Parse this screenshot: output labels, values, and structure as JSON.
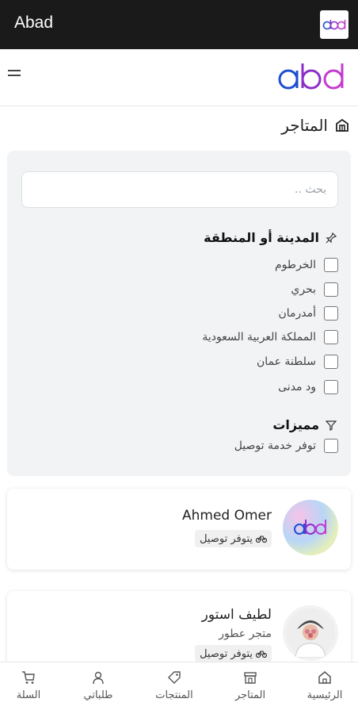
{
  "window": {
    "title": "Abad",
    "app_icon": "abd-logo-icon"
  },
  "header": {
    "menu_icon": "hamburger-icon",
    "logo": "abd"
  },
  "page": {
    "title": "المتاجر",
    "title_icon": "store-icon"
  },
  "filters": {
    "search": {
      "value": "",
      "placeholder": "بحث .."
    },
    "region": {
      "title": "المدينة أو المنطقة",
      "icon": "pin-icon",
      "options": [
        {
          "label": "الخرطوم",
          "checked": false
        },
        {
          "label": "بحري",
          "checked": false
        },
        {
          "label": "أمدرمان",
          "checked": false
        },
        {
          "label": "المملكة العربية السعودية",
          "checked": false
        },
        {
          "label": "سلطنة عمان",
          "checked": false
        },
        {
          "label": "ود مدنى",
          "checked": false
        }
      ]
    },
    "features": {
      "title": "مميزات",
      "icon": "filter-icon",
      "options": [
        {
          "label": "توفر خدمة توصيل",
          "checked": false
        }
      ]
    }
  },
  "stores": [
    {
      "name": "Ahmed Omer",
      "category": "",
      "badge": "يتوفر توصيل",
      "avatar": "abd-logo-avatar"
    },
    {
      "name": "لطيف استور",
      "category": "متجر عطور",
      "badge": "يتوفر توصيل",
      "avatar": "person-avatar"
    }
  ],
  "bottom_nav": [
    {
      "label": "الرئيسية",
      "icon": "home-icon"
    },
    {
      "label": "المتاجر",
      "icon": "store-icon"
    },
    {
      "label": "المنتجات",
      "icon": "tag-icon"
    },
    {
      "label": "طلباتي",
      "icon": "user-icon"
    },
    {
      "label": "السلة",
      "icon": "cart-icon"
    }
  ],
  "colors": {
    "logo_blue": "#1e4fd1",
    "logo_purple": "#8b2fc9",
    "logo_magenta": "#c43bd0"
  }
}
